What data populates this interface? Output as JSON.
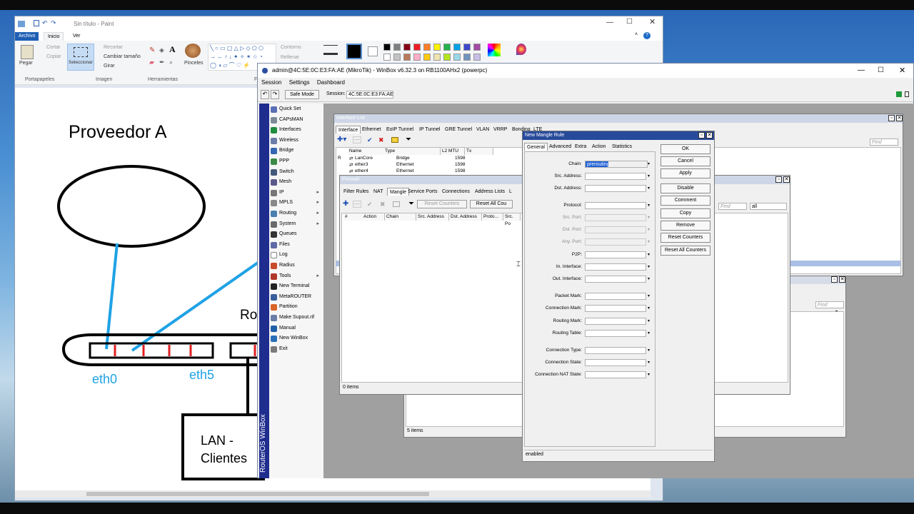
{
  "paint": {
    "title": "Sin título - Paint",
    "tabs": [
      "Archivo",
      "Inicio",
      "Ver"
    ],
    "clipboard": {
      "paste": "Pegar",
      "cut": "Cortar",
      "copy": "Copiar",
      "group": "Portapapeles"
    },
    "image": {
      "select": "Seleccionar",
      "crop": "Recortar",
      "resize": "Cambiar tamaño",
      "rotate": "Girar",
      "group": "Imagen"
    },
    "tools": {
      "group": "Herramientas",
      "text_tool": "A"
    },
    "brushes": "Pinceles",
    "shapes": {
      "outline": "Contorno",
      "fill": "Rellenar",
      "group": "Fo"
    },
    "colors": [
      "#000000",
      "#7f7f7f",
      "#880015",
      "#ed1c24",
      "#ff7f27",
      "#fff200",
      "#22b14c",
      "#00a2e8",
      "#3f48cc",
      "#a349a4",
      "#ffffff",
      "#c3c3c3",
      "#b97a57",
      "#ffaec9",
      "#ffc90e",
      "#efe4b0",
      "#b5e61d",
      "#99d9ea",
      "#7092be",
      "#c8bfe7"
    ],
    "canvas": {
      "provider_label": "Proveedor A",
      "router_label": "Ro",
      "eth0": "eth0",
      "eth5": "eth5",
      "lan_line1": "LAN -",
      "lan_line2": "Clientes"
    }
  },
  "winbox": {
    "title": "admin@4C:5E:0C:E3:FA:AE (MikroTik) - WinBox v6.32.3 on RB1100AHx2 (powerpc)",
    "menu": [
      "Session",
      "Settings",
      "Dashboard"
    ],
    "safe_mode": "Safe Mode",
    "session_label": "Session:",
    "session_value": "4C:5E:0C:E3:FA:AE",
    "brand_vertical": "RouterOS WinBox",
    "sidebar": [
      {
        "label": "Quick Set",
        "icon": "#5a6fb5",
        "arrow": ""
      },
      {
        "label": "CAPsMAN",
        "icon": "#7e8b99",
        "arrow": ""
      },
      {
        "label": "Interfaces",
        "icon": "#1f8c3e",
        "arrow": ""
      },
      {
        "label": "Wireless",
        "icon": "#6a7da8",
        "arrow": ""
      },
      {
        "label": "Bridge",
        "icon": "#3466b2",
        "arrow": ""
      },
      {
        "label": "PPP",
        "icon": "#3b8b47",
        "arrow": ""
      },
      {
        "label": "Switch",
        "icon": "#445a7c",
        "arrow": ""
      },
      {
        "label": "Mesh",
        "icon": "#5a5a8a",
        "arrow": ""
      },
      {
        "label": "IP",
        "icon": "#777777",
        "arrow": "▸"
      },
      {
        "label": "MPLS",
        "icon": "#888888",
        "arrow": "▸"
      },
      {
        "label": "Routing",
        "icon": "#4a7fb0",
        "arrow": "▸"
      },
      {
        "label": "System",
        "icon": "#6a6a6a",
        "arrow": "▸"
      },
      {
        "label": "Queues",
        "icon": "#333333",
        "arrow": ""
      },
      {
        "label": "Files",
        "icon": "#5e6aa6",
        "arrow": ""
      },
      {
        "label": "Log",
        "icon": "#ffffff",
        "arrow": ""
      },
      {
        "label": "Radius",
        "icon": "#c84b2a",
        "arrow": ""
      },
      {
        "label": "Tools",
        "icon": "#b0372b",
        "arrow": "▸"
      },
      {
        "label": "New Terminal",
        "icon": "#222222",
        "arrow": ""
      },
      {
        "label": "MetaROUTER",
        "icon": "#3a5f9a",
        "arrow": ""
      },
      {
        "label": "Partition",
        "icon": "#d9642a",
        "arrow": ""
      },
      {
        "label": "Make Supout.rif",
        "icon": "#6a7da8",
        "arrow": ""
      },
      {
        "label": "Manual",
        "icon": "#1f5fa8",
        "arrow": ""
      },
      {
        "label": "New WinBox",
        "icon": "#2a6fb8",
        "arrow": ""
      },
      {
        "label": "Exit",
        "icon": "#7a7a7a",
        "arrow": ""
      }
    ],
    "interface_list": {
      "title": "Interface List",
      "tabs": [
        "Interface",
        "Ethernet",
        "EoIP Tunnel",
        "IP Tunnel",
        "GRE Tunnel",
        "VLAN",
        "VRRP",
        "Bonding",
        "LTE"
      ],
      "columns": [
        "Name",
        "Type",
        "L2 MTU",
        "Tx"
      ],
      "rows": [
        {
          "flag": "R",
          "name": "LanCore",
          "type": "Bridge",
          "mtu": "1598"
        },
        {
          "flag": "",
          "name": "ether3",
          "type": "Ethernet",
          "mtu": "1598"
        },
        {
          "flag": "",
          "name": "ether4",
          "type": "Ethernet",
          "mtu": "1598"
        }
      ],
      "find_placeholder": "Find"
    },
    "firewall": {
      "title": "Firewall",
      "tabs": [
        "Filter Rules",
        "NAT",
        "Mangle",
        "Service Ports",
        "Connections",
        "Address Lists",
        "L"
      ],
      "reset_counters": "Reset Counters",
      "reset_all": "Reset All Cou",
      "columns": [
        "#",
        "Action",
        "Chain",
        "Src. Address",
        "Dst. Address",
        "Proto...",
        "Src. Po"
      ],
      "status": "0 items",
      "find_placeholder": "Find",
      "filter_value": "all"
    },
    "back_window": {
      "status": "5 items",
      "find_placeholder": "Find"
    },
    "mangle_rule": {
      "title": "New Mangle Rule",
      "tabs": [
        "General",
        "Advanced",
        "Extra",
        "Action",
        "Statistics"
      ],
      "fields": [
        {
          "label": "Chain:",
          "value": "prerouting",
          "disabled": false
        },
        {
          "label": "Src. Address:",
          "value": "",
          "disabled": false
        },
        {
          "label": "Dst. Address:",
          "value": "",
          "disabled": false
        },
        {
          "label": "Protocol:",
          "value": "",
          "disabled": false
        },
        {
          "label": "Src. Port:",
          "value": "",
          "disabled": true
        },
        {
          "label": "Dst. Port:",
          "value": "",
          "disabled": true
        },
        {
          "label": "Any. Port:",
          "value": "",
          "disabled": true
        },
        {
          "label": "P2P:",
          "value": "",
          "disabled": false
        },
        {
          "label": "In. Interface:",
          "value": "",
          "disabled": false
        },
        {
          "label": "Out. Interface:",
          "value": "",
          "disabled": false
        },
        {
          "label": "Packet Mark:",
          "value": "",
          "disabled": false
        },
        {
          "label": "Connection Mark:",
          "value": "",
          "disabled": false
        },
        {
          "label": "Routing Mark:",
          "value": "",
          "disabled": false
        },
        {
          "label": "Routing Table:",
          "value": "",
          "disabled": false
        },
        {
          "label": "Connection Type:",
          "value": "",
          "disabled": false
        },
        {
          "label": "Connection State:",
          "value": "",
          "disabled": false
        },
        {
          "label": "Connection NAT State:",
          "value": "",
          "disabled": false
        }
      ],
      "buttons": [
        "OK",
        "Cancel",
        "Apply",
        "Disable",
        "Comment",
        "Copy",
        "Remove",
        "Reset Counters",
        "Reset All Counters"
      ],
      "status": "enabled"
    }
  }
}
